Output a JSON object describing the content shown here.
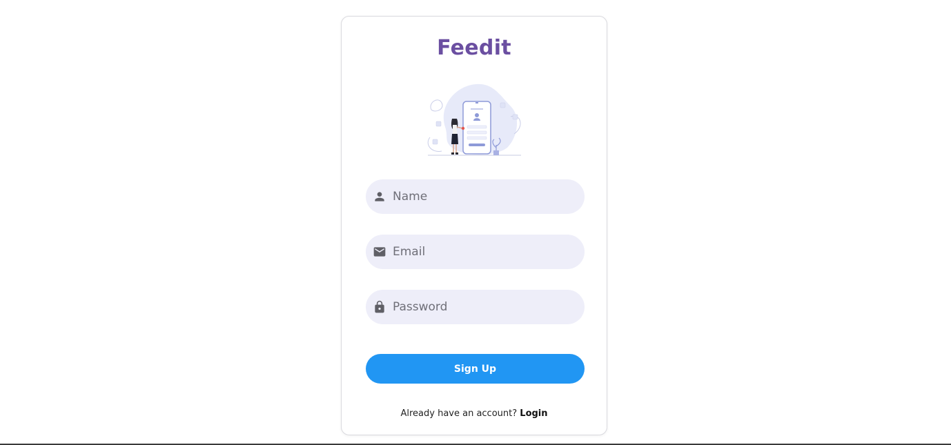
{
  "brand": {
    "title": "Feedit"
  },
  "form": {
    "name": {
      "placeholder": "Name",
      "value": "",
      "icon": "person-icon"
    },
    "email": {
      "placeholder": "Email",
      "value": "",
      "icon": "mail-icon"
    },
    "password": {
      "placeholder": "Password",
      "value": "",
      "icon": "lock-icon"
    },
    "submit_label": "Sign Up"
  },
  "footer": {
    "prompt": "Already have an account?",
    "login_label": "Login"
  },
  "colors": {
    "brand": "#6b4fa1",
    "field_bg": "#eeeef9",
    "button": "#2196f3",
    "icon": "#5f5f66"
  }
}
